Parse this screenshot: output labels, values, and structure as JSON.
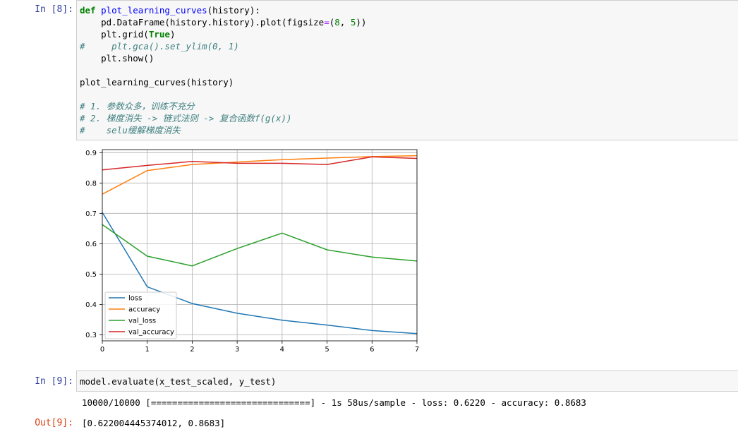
{
  "cells": {
    "in8": {
      "prompt": "In  [8]:",
      "code": {
        "line1_kw": "def",
        "line1_fn": "plot_learning_curves",
        "line1_rest": "(history):",
        "line2_a": "    pd.DataFrame(history.history).plot(figsize",
        "line2_op": "=",
        "line2_b": "(",
        "line2_n1": "8",
        "line2_c": ", ",
        "line2_n2": "5",
        "line2_d": "))",
        "line3_a": "    plt.grid(",
        "line3_kw": "True",
        "line3_b": ")",
        "line4_hash": "#",
        "line4_comment": "     plt.gca().set_ylim(0, 1)",
        "line5": "    plt.show()",
        "line7": "plot_learning_curves(history)",
        "line9": "# 1. 参数众多，训练不充分",
        "line10": "# 2. 梯度消失 -> 链式法则 -> 复合函数f(g(x))",
        "line11": "#    selu缓解梯度消失"
      }
    },
    "in9": {
      "prompt": "In  [9]:",
      "code": "model.evaluate(x_test_scaled, y_test)",
      "stream": "10000/10000 [==============================] - 1s 58us/sample - loss: 0.6220 - accuracy: 0.8683"
    },
    "out9": {
      "prompt": "Out[9]:",
      "result": "[0.622004445374012, 0.8683]"
    }
  },
  "chart_data": {
    "type": "line",
    "x": [
      0,
      1,
      2,
      3,
      4,
      5,
      6,
      7
    ],
    "xlim": [
      0,
      7
    ],
    "ylim": [
      0.28,
      0.91
    ],
    "yticks": [
      0.3,
      0.4,
      0.5,
      0.6,
      0.7,
      0.8,
      0.9
    ],
    "xticks": [
      0,
      1,
      2,
      3,
      4,
      5,
      6,
      7
    ],
    "grid": true,
    "legend_position": "lower-left",
    "series": [
      {
        "name": "loss",
        "color": "#1f77b4",
        "values": [
          0.703,
          0.458,
          0.403,
          0.371,
          0.348,
          0.332,
          0.314,
          0.304
        ]
      },
      {
        "name": "accuracy",
        "color": "#ff7f0e",
        "values": [
          0.763,
          0.841,
          0.861,
          0.869,
          0.877,
          0.882,
          0.887,
          0.89
        ]
      },
      {
        "name": "val_loss",
        "color": "#2ca02c",
        "values": [
          0.663,
          0.559,
          0.527,
          0.584,
          0.635,
          0.58,
          0.556,
          0.543
        ]
      },
      {
        "name": "val_accuracy",
        "color": "#d62728",
        "values": [
          0.843,
          0.858,
          0.871,
          0.865,
          0.865,
          0.861,
          0.886,
          0.881
        ]
      }
    ]
  }
}
